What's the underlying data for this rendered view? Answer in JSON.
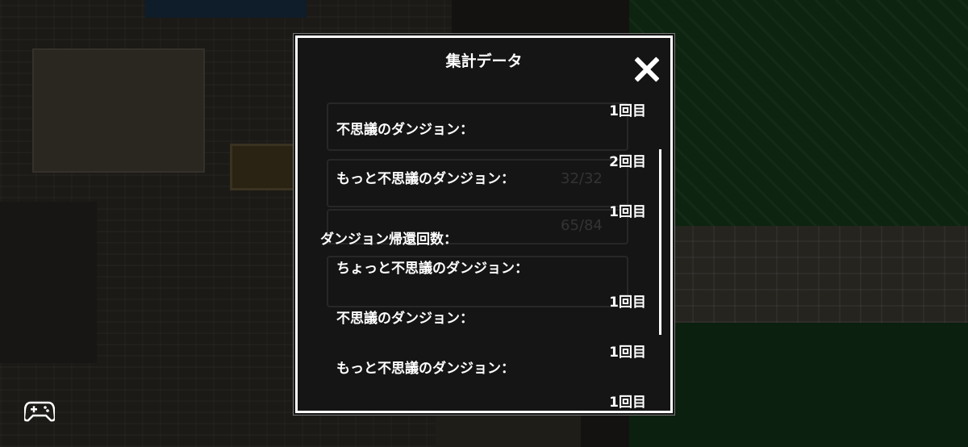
{
  "dialog": {
    "title": "集計データ",
    "rows": [
      {
        "value": "1回目"
      },
      {
        "label": "不思議のダンジョン："
      },
      {
        "value": "2回目"
      },
      {
        "label": "もっと不思議のダンジョン："
      },
      {
        "value": "1回目"
      },
      {
        "section": "ダンジョン帰還回数："
      },
      {
        "label": "ちょっと不思議のダンジョン："
      },
      {
        "value": "1回目"
      },
      {
        "label": "不思議のダンジョン："
      },
      {
        "value": "1回目"
      },
      {
        "label": "もっと不思議のダンジョン："
      },
      {
        "value": "1回目"
      }
    ],
    "ghost": [
      "32/32",
      "65/84"
    ]
  },
  "icons": {
    "close": "close-icon",
    "controller": "gamepad-icon"
  }
}
